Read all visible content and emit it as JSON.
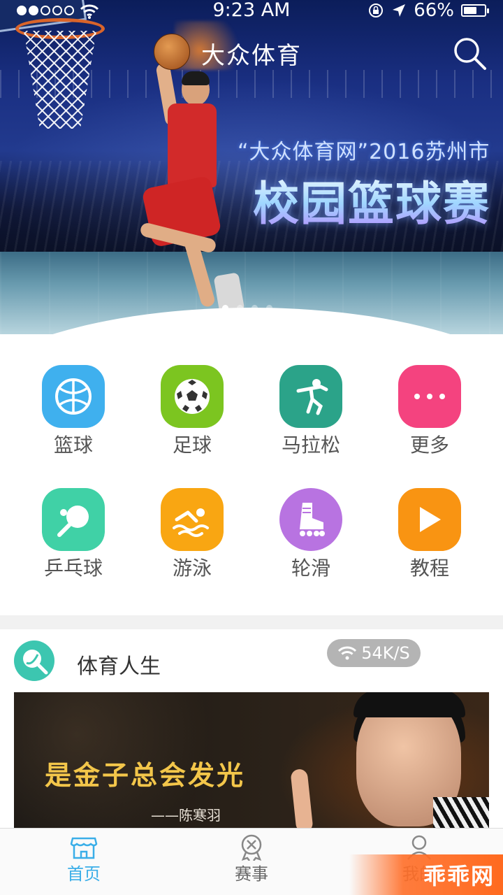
{
  "status_bar": {
    "time": "9:23 AM",
    "battery": "66%",
    "battery_level": 0.66,
    "signal_dots_filled": 2,
    "signal_dots_total": 5
  },
  "header": {
    "title": "大众体育",
    "search_icon": "search-icon"
  },
  "banner": {
    "subtitle": "“大众体育网”2016苏州市",
    "headline": "校园篮球赛",
    "page_count": 4,
    "active_page": 1
  },
  "categories": [
    {
      "label": "篮球",
      "icon": "basketball-icon",
      "color": "#3fb0ee"
    },
    {
      "label": "足球",
      "icon": "soccer-ball-icon",
      "color": "#7cc520"
    },
    {
      "label": "马拉松",
      "icon": "runner-icon",
      "color": "#2ba389"
    },
    {
      "label": "更多",
      "icon": "more-dots-icon",
      "color": "#f4437f"
    },
    {
      "label": "乒乓球",
      "icon": "ping-pong-icon",
      "color": "#40d1a6"
    },
    {
      "label": "游泳",
      "icon": "swimmer-icon",
      "color": "#f9a612"
    },
    {
      "label": "轮滑",
      "icon": "roller-skate-icon",
      "color": "#b873e1"
    },
    {
      "label": "教程",
      "icon": "play-icon",
      "color": "#f99412"
    }
  ],
  "section": {
    "title": "体育人生",
    "speed_badge": "54K/S",
    "video": {
      "quote": "是金子总会发光",
      "author": "——陈寒羽"
    }
  },
  "tabbar": {
    "items": [
      {
        "label": "首页",
        "icon": "home-store-icon",
        "active": true
      },
      {
        "label": "赛事",
        "icon": "medal-icon",
        "active": false
      },
      {
        "label": "我的",
        "icon": "user-icon",
        "active": false
      }
    ],
    "active_color": "#3aaee8"
  },
  "watermark": "乖乖网"
}
